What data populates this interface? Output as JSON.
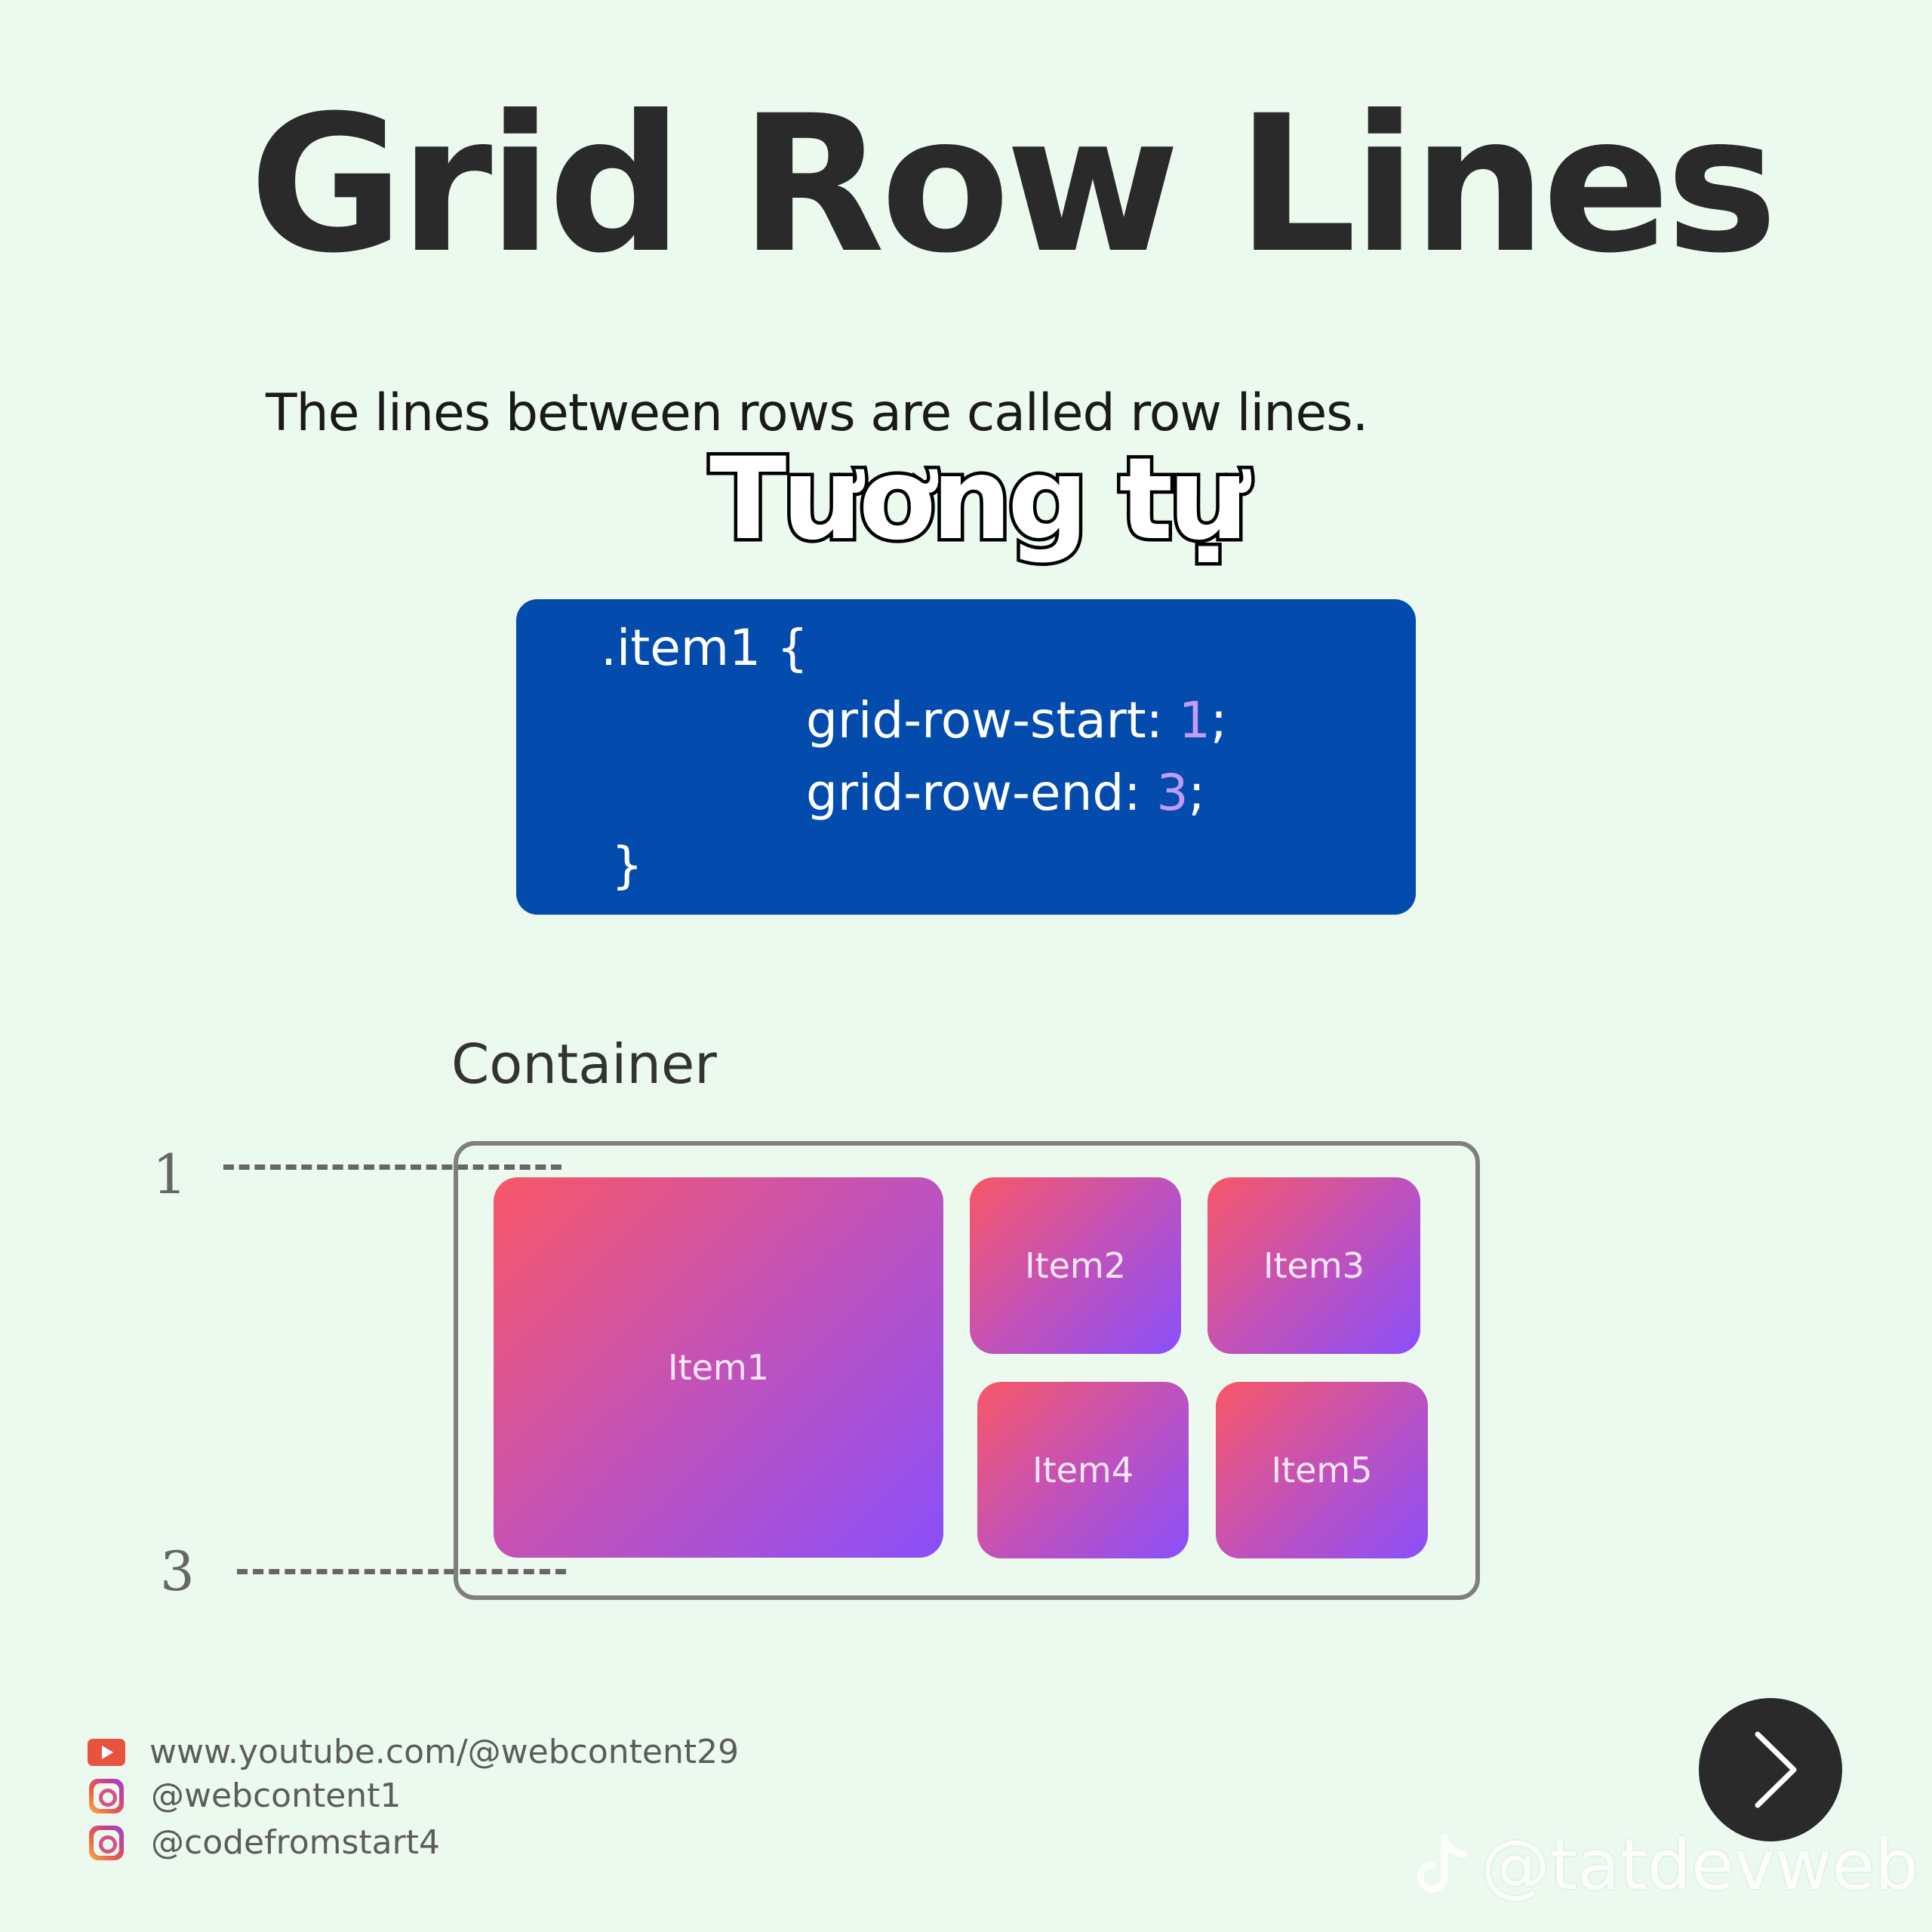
{
  "title": "Grid Row Lines",
  "subtitle": "The lines between rows are called row lines.",
  "caption": "Tương tự",
  "code": {
    "selector": ".item1 {",
    "prop1_name": "grid-row-start: ",
    "prop1_value": "1",
    "prop2_name": "grid-row-end: ",
    "prop2_value": "3",
    "semicolon": ";",
    "closing": "}"
  },
  "container_label": "Container",
  "row_lines": [
    "1",
    "3"
  ],
  "items": [
    "Item1",
    "Item2",
    "Item3",
    "Item4",
    "Item5"
  ],
  "socials": [
    {
      "icon": "youtube-icon",
      "text": "www.youtube.com/@webcontent29"
    },
    {
      "icon": "instagram-icon",
      "text": "@webcontent1"
    },
    {
      "icon": "instagram-icon",
      "text": "@codefromstart4"
    }
  ],
  "watermark": "@tatdevweb",
  "next_button_icon": "chevron-right-icon",
  "colors": {
    "background": "#ebf9ef",
    "code_bg": "#034cad",
    "code_number": "#c49cff",
    "item_gradient_start": "#f85767",
    "item_gradient_end": "#8a4ffa"
  }
}
